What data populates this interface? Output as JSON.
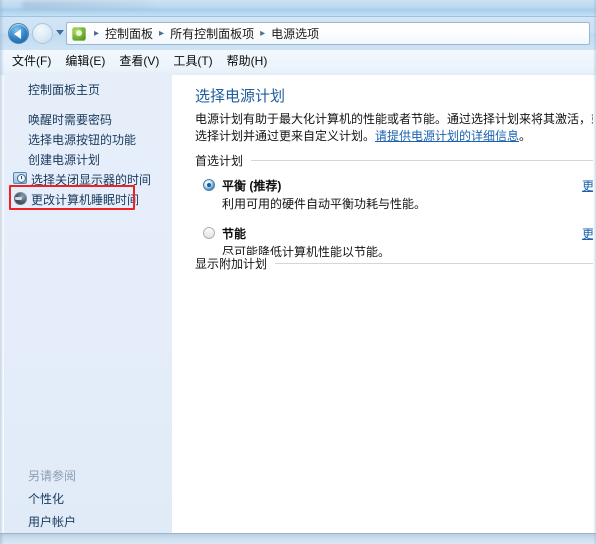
{
  "window": {
    "titlebar_blank": ""
  },
  "nav": {
    "back_label": "后退",
    "forward_label": "前进",
    "dropdown_label": "最近的位置",
    "breadcrumbs": [
      "控制面板",
      "所有控制面板项",
      "电源选项"
    ],
    "separator": "▸",
    "crumb_icon": "control-panel-icon"
  },
  "menubar": {
    "items": [
      "文件(F)",
      "编辑(E)",
      "查看(V)",
      "工具(T)",
      "帮助(H)"
    ]
  },
  "sidebar": {
    "home": "控制面板主页",
    "links": [
      "唤醒时需要密码",
      "选择电源按钮的功能",
      "创建电源计划"
    ],
    "icon_links": [
      {
        "label": "选择关闭显示器的时间",
        "icon": "monitor-clock-icon"
      },
      {
        "label": "更改计算机睡眠时间",
        "icon": "moon-sleep-icon"
      }
    ],
    "see_also": {
      "title": "另请参阅",
      "links": [
        "个性化",
        "用户帐户"
      ]
    }
  },
  "annotation": {
    "highlight_color": "#ee2222",
    "target": "更改计算机睡眠时间"
  },
  "main": {
    "title": "选择电源计划",
    "description_part1": "电源计划有助于最大化计算机的性能或者节能。通过选择计划来将其激活，或选择计划并通过更",
    "description_link": "请提供电源计划的详细信息",
    "description_part2": "来自定义计划。",
    "description_tail": "。",
    "groups": {
      "preferred": "首选计划",
      "additional": "显示附加计划"
    },
    "plans": [
      {
        "name": "平衡 (推荐)",
        "description": "利用可用的硬件自动平衡功耗与性能。",
        "selected": true,
        "change_label": "更改"
      },
      {
        "name": "节能",
        "description": "尽可能降低计算机性能以节能。",
        "selected": false,
        "change_label": "更改"
      }
    ]
  },
  "colors": {
    "accent_blue": "#1f5c9e",
    "link_blue": "#1b62ad",
    "sidebar_bg": "#e4edf9",
    "highlight_red": "#ee2222"
  }
}
